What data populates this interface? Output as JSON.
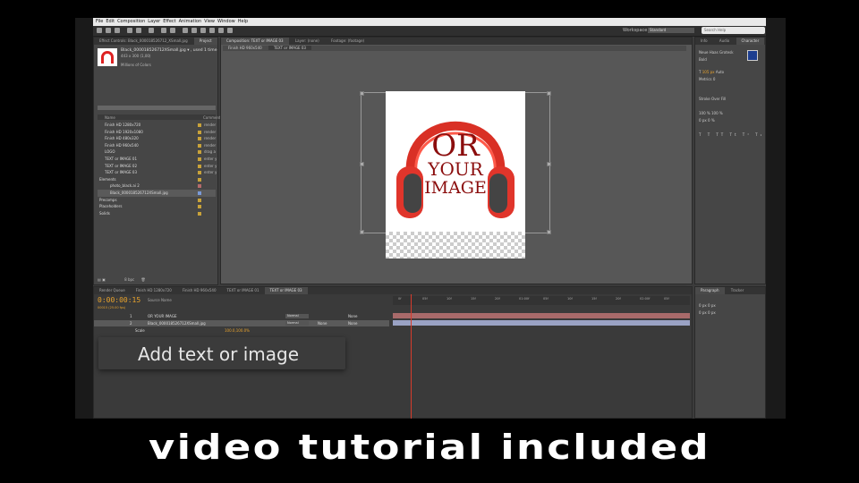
{
  "menu": [
    "File",
    "Edit",
    "Composition",
    "Layer",
    "Effect",
    "Animation",
    "View",
    "Window",
    "Help"
  ],
  "workspace": {
    "label": "Workspace:",
    "value": "Standard",
    "search_placeholder": "Search Help"
  },
  "project_panel": {
    "tabs": [
      "Project",
      "Effect Controls: Black_000018526712_XSmall.jpg"
    ],
    "file_name": "Black_000018526712XSmall.jpg",
    "used": "used 1 time",
    "dimensions": "443 x 300 (1,00)",
    "colors": "Millions of Colors",
    "columns": {
      "name": "Name",
      "type": "Comment"
    },
    "items": [
      {
        "name": "Finish HD 1280x720",
        "type": "render",
        "color": "#c8a23a"
      },
      {
        "name": "Finish HD 1920x1080",
        "type": "render",
        "color": "#c8a23a"
      },
      {
        "name": "Finish HD 480x320",
        "type": "render",
        "color": "#c8a23a"
      },
      {
        "name": "Finish HD 960x540",
        "type": "render",
        "color": "#c8a23a"
      },
      {
        "name": "LOGO",
        "type": "drag a",
        "color": "#c8a23a"
      },
      {
        "name": "TEXT or IMAGE 01",
        "type": "enter y",
        "color": "#c8a23a"
      },
      {
        "name": "TEXT or IMAGE 02",
        "type": "enter y",
        "color": "#c8a23a"
      },
      {
        "name": "TEXT or IMAGE 03",
        "type": "enter y",
        "color": "#c8a23a"
      },
      {
        "name": "Elements",
        "type": "",
        "color": "#c8a23a"
      },
      {
        "name": "photo_black.ai 2",
        "type": "",
        "color": "#b56b6b"
      },
      {
        "name": "Black_000018526712XSmall.jpg",
        "type": "",
        "color": "#7a9ad8"
      },
      {
        "name": "Precomps",
        "type": "",
        "color": "#c8a23a"
      },
      {
        "name": "Placeholders",
        "type": "",
        "color": "#c8a23a"
      },
      {
        "name": "Solids",
        "type": "",
        "color": "#c8a23a"
      }
    ],
    "bpc": "8 bpc"
  },
  "composition_panel": {
    "tabs": [
      "Composition: TEXT or IMAGE 03",
      "Layer: (none)",
      "Footage: (footage)"
    ],
    "breadcrumb": [
      "Finish HD 960x540",
      "TEXT or IMAGE 03"
    ],
    "artwork": {
      "line1": "OR",
      "line2": "YOUR",
      "line3": "IMAGE"
    },
    "viewer": {
      "zoom": "100%",
      "timecode": "0:00:00:15",
      "resolution": "Full",
      "camera": "Active Camera",
      "views": "1 View",
      "offset": "+0,0"
    }
  },
  "character_panel": {
    "tabs": [
      "Info",
      "Audio",
      "Character"
    ],
    "font": "Neue Haas Grotesk",
    "style": "Bold",
    "size": "105 px",
    "leading": "Auto",
    "tracking": "0",
    "kerning": "Metrics",
    "stroke": "Stroke Over Fill",
    "scale_v": "100 %",
    "scale_h": "100 %",
    "baseline": "0 px",
    "tsume": "0 %"
  },
  "paragraph_panel": {
    "tabs": [
      "Paragraph",
      "Tracker"
    ],
    "values": [
      "0 px",
      "0 px",
      "0 px",
      "0 px",
      "0 px"
    ]
  },
  "timeline": {
    "tabs": [
      "Render Queue",
      "Finish HD 1280x720",
      "Finish HD 960x540",
      "TEXT or IMAGE 01",
      "TEXT or IMAGE 03"
    ],
    "timecode": "0:00:00:15",
    "timecode_sub": "00015 (25.00 fps)",
    "column_header": "Source Name",
    "layers": [
      {
        "num": "1",
        "name": "OR YOUR IMAGE",
        "mode": "Normal",
        "trkmat": "",
        "parent": "None"
      },
      {
        "num": "2",
        "name": "Black_000018526712XSmall.jpg",
        "mode": "Normal",
        "trkmat": "None",
        "parent": "None"
      }
    ],
    "property": {
      "name": "Scale",
      "value": "100.0,100.0%"
    },
    "ruler": [
      "0f",
      "05f",
      "10f",
      "15f",
      "20f",
      "01:00f",
      "05f",
      "10f",
      "15f",
      "20f",
      "02:00f",
      "05f"
    ]
  },
  "overlay": {
    "text": "Add text or image"
  },
  "caption": {
    "text": "video tutorial included"
  }
}
